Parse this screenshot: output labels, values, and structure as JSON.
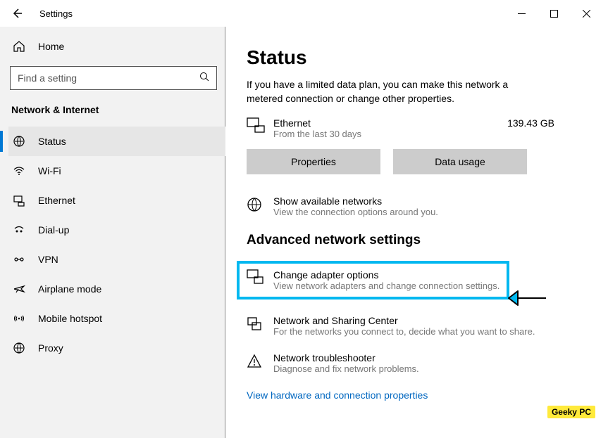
{
  "window": {
    "title": "Settings"
  },
  "sidebar": {
    "home_label": "Home",
    "search_placeholder": "Find a setting",
    "category": "Network & Internet",
    "items": [
      {
        "label": "Status"
      },
      {
        "label": "Wi-Fi"
      },
      {
        "label": "Ethernet"
      },
      {
        "label": "Dial-up"
      },
      {
        "label": "VPN"
      },
      {
        "label": "Airplane mode"
      },
      {
        "label": "Mobile hotspot"
      },
      {
        "label": "Proxy"
      }
    ]
  },
  "page": {
    "title": "Status",
    "metered_desc": "If you have a limited data plan, you can make this network a metered connection or change other properties.",
    "ethernet": {
      "name": "Ethernet",
      "sub": "From the last 30 days",
      "size": "139.43 GB"
    },
    "properties_btn": "Properties",
    "usage_btn": "Data usage",
    "show_networks": {
      "name": "Show available networks",
      "sub": "View the connection options around you."
    },
    "h2": "Advanced network settings",
    "adapter": {
      "name": "Change adapter options",
      "sub": "View network adapters and change connection settings."
    },
    "sharing": {
      "name": "Network and Sharing Center",
      "sub": "For the networks you connect to, decide what you want to share."
    },
    "troubleshoot": {
      "name": "Network troubleshooter",
      "sub": "Diagnose and fix network problems."
    },
    "link": "View hardware and connection properties"
  },
  "watermark": "Geeky PC"
}
